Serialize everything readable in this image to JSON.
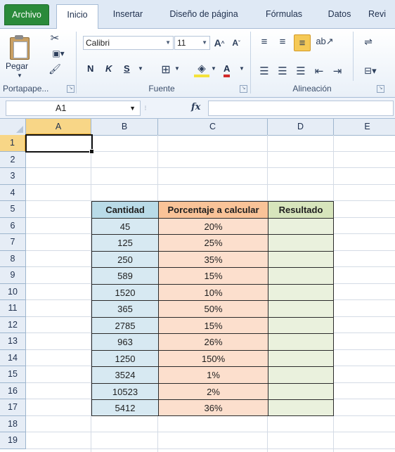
{
  "ribbon": {
    "tabs": [
      "Archivo",
      "Inicio",
      "Insertar",
      "Diseño de página",
      "Fórmulas",
      "Datos",
      "Revi"
    ],
    "active_tab": "Inicio",
    "clipboard": {
      "paste_label": "Pegar",
      "group_label": "Portapape..."
    },
    "font": {
      "name": "Calibri",
      "size": "11",
      "bold": "N",
      "italic": "K",
      "underline": "S",
      "color_letter": "A",
      "group_label": "Fuente"
    },
    "alignment": {
      "group_label": "Alineación"
    }
  },
  "formula_bar": {
    "name_box": "A1",
    "fx": "fx",
    "formula": ""
  },
  "columns": [
    "A",
    "B",
    "C",
    "D",
    "E"
  ],
  "rows": [
    "1",
    "2",
    "3",
    "4",
    "5",
    "6",
    "7",
    "8",
    "9",
    "10",
    "11",
    "12",
    "13",
    "14",
    "15",
    "16",
    "17",
    "18",
    "19"
  ],
  "selected_cell": "A1",
  "colors": {
    "file_tab": "#2a8a3a",
    "cantidad": "#d7e9f2",
    "porcentaje": "#fcdfcd",
    "resultado": "#eaf1dd"
  },
  "table": {
    "headers": [
      "Cantidad",
      "Porcentaje a calcular",
      "Resultado"
    ],
    "rows": [
      [
        "45",
        "20%",
        ""
      ],
      [
        "125",
        "25%",
        ""
      ],
      [
        "250",
        "35%",
        ""
      ],
      [
        "589",
        "15%",
        ""
      ],
      [
        "1520",
        "10%",
        ""
      ],
      [
        "365",
        "50%",
        ""
      ],
      [
        "2785",
        "15%",
        ""
      ],
      [
        "963",
        "26%",
        ""
      ],
      [
        "1250",
        "150%",
        ""
      ],
      [
        "3524",
        "1%",
        ""
      ],
      [
        "10523",
        "2%",
        ""
      ],
      [
        "5412",
        "36%",
        ""
      ]
    ]
  }
}
